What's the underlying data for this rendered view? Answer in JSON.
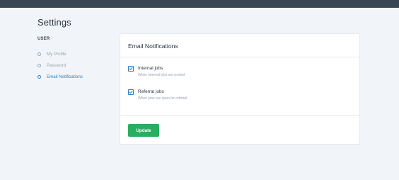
{
  "page": {
    "title": "Settings"
  },
  "sidebar": {
    "section_label": "USER",
    "items": [
      {
        "label": "My Profile",
        "active": false
      },
      {
        "label": "Password",
        "active": false
      },
      {
        "label": "Email Notifications",
        "active": true
      }
    ]
  },
  "card": {
    "title": "Email Notifications",
    "options": [
      {
        "title": "Internal jobs",
        "description": "When internal jobs are posted",
        "checked": true
      },
      {
        "title": "Referral jobs",
        "description": "When jobs are open for referral",
        "checked": true
      }
    ],
    "submit_label": "Update"
  },
  "colors": {
    "accent": "#2f80c8",
    "button": "#27ae60",
    "topbar": "#394654",
    "background": "#f1f4f8"
  }
}
